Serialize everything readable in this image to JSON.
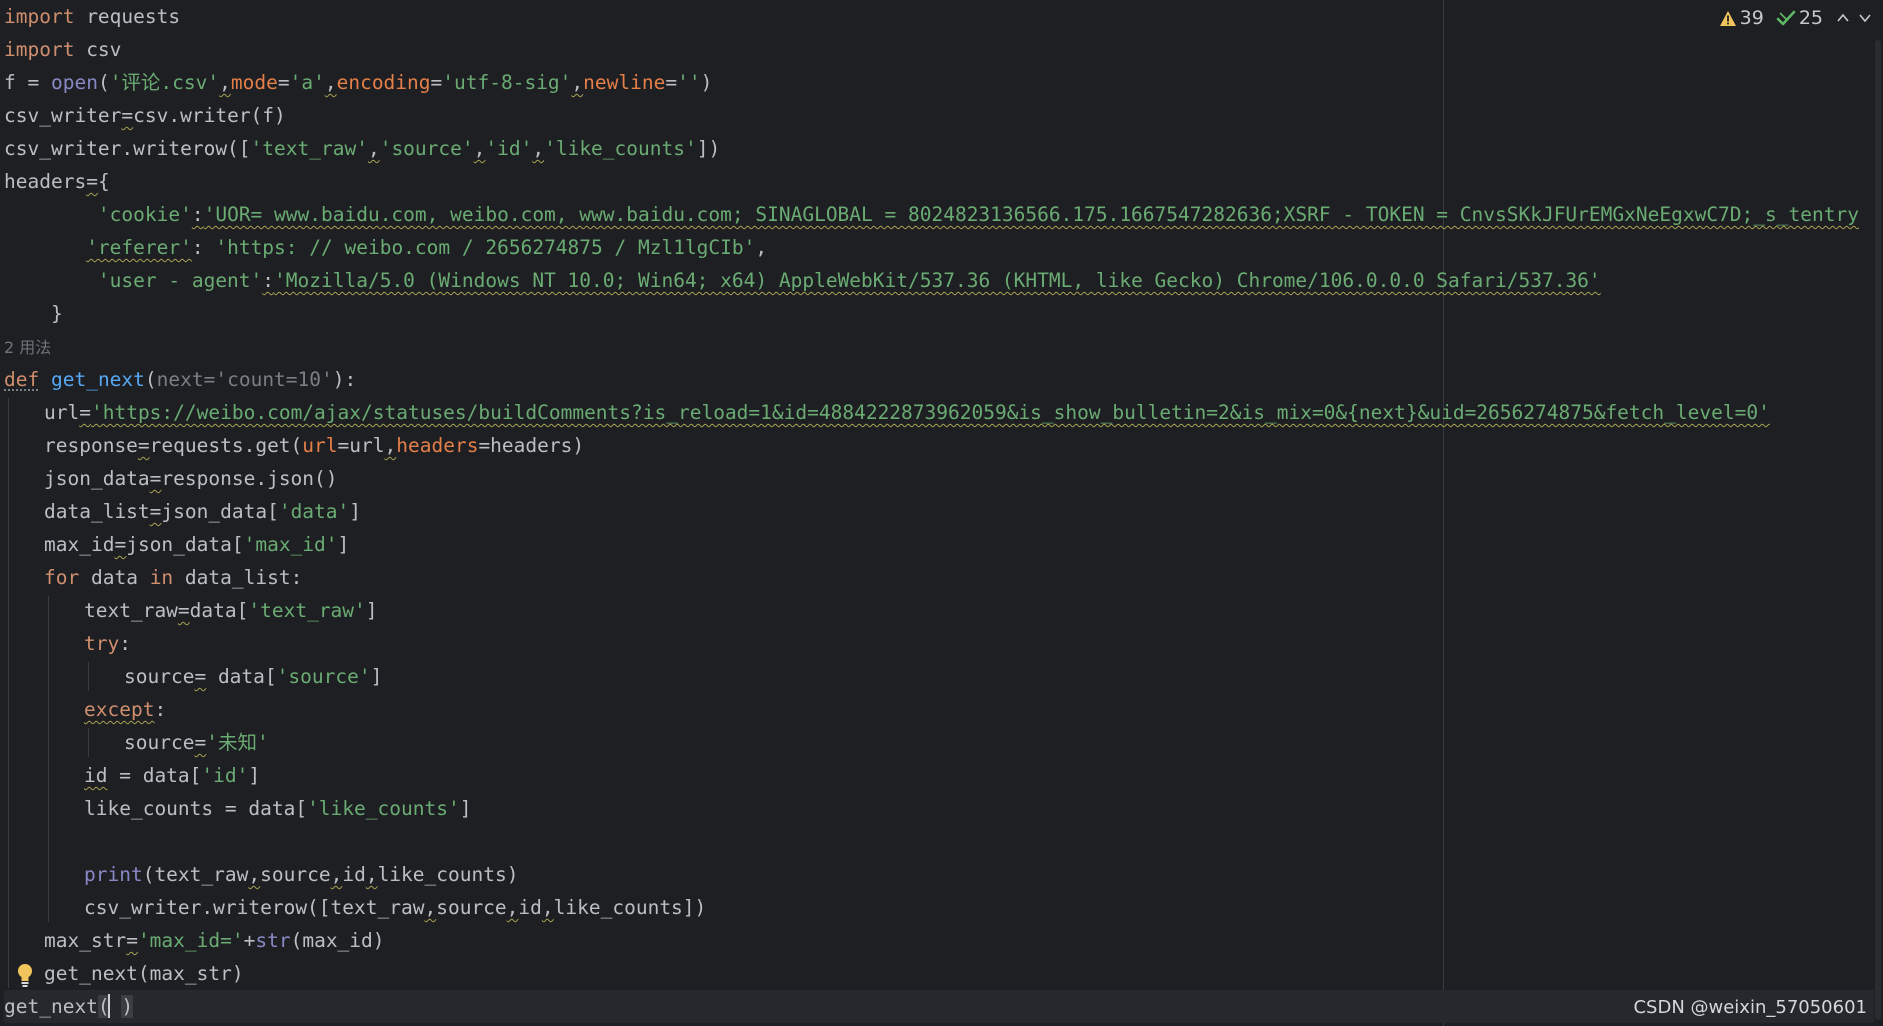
{
  "inspection_widget": {
    "warning_count": "39",
    "weak_warning_count": "25"
  },
  "usage_hint": "2 用法",
  "watermark": "CSDN @weixin_57050601",
  "colors": {
    "background": "#1e1f22",
    "keyword": "#cf8e6d",
    "string": "#6aab73",
    "function": "#56a8f5",
    "builtin": "#8888c6",
    "parameter": "#e57f4a",
    "default_text": "#bcbec4"
  },
  "code_lines": [
    {
      "indent": 0,
      "tokens": [
        {
          "t": "import",
          "c": "kw"
        },
        {
          "t": " requests"
        }
      ]
    },
    {
      "indent": 0,
      "tokens": [
        {
          "t": "import",
          "c": "kw"
        },
        {
          "t": " csv"
        }
      ]
    },
    {
      "indent": 0,
      "tokens": [
        {
          "t": "f = "
        },
        {
          "t": "open",
          "c": "bi"
        },
        {
          "t": "("
        },
        {
          "t": "'评论.csv'",
          "c": "str"
        },
        {
          "t": ",",
          "w": 1
        },
        {
          "t": "mode",
          "c": "param"
        },
        {
          "t": "="
        },
        {
          "t": "'a'",
          "c": "str"
        },
        {
          "t": ",",
          "w": 1
        },
        {
          "t": "encoding",
          "c": "param"
        },
        {
          "t": "="
        },
        {
          "t": "'utf-8-sig'",
          "c": "str"
        },
        {
          "t": ",",
          "w": 1
        },
        {
          "t": "newline",
          "c": "param"
        },
        {
          "t": "="
        },
        {
          "t": "''",
          "c": "str"
        },
        {
          "t": ")"
        }
      ]
    },
    {
      "indent": 0,
      "tokens": [
        {
          "t": "csv_writer"
        },
        {
          "t": "=",
          "w": 1
        },
        {
          "t": "csv.writer(f)"
        }
      ]
    },
    {
      "indent": 0,
      "tokens": [
        {
          "t": "csv_writer.writerow(["
        },
        {
          "t": "'text_raw'",
          "c": "str"
        },
        {
          "t": ",",
          "w": 1
        },
        {
          "t": "'source'",
          "c": "str"
        },
        {
          "t": ",",
          "w": 1
        },
        {
          "t": "'id'",
          "c": "str"
        },
        {
          "t": ",",
          "w": 1
        },
        {
          "t": "'like_counts'",
          "c": "str"
        },
        {
          "t": "])"
        }
      ]
    },
    {
      "indent": 0,
      "tokens": [
        {
          "t": "headers"
        },
        {
          "t": "=",
          "w": 1
        },
        {
          "t": "{"
        }
      ]
    },
    {
      "indent": 0,
      "tokens": [
        {
          "t": "        "
        },
        {
          "t": "'cookie'",
          "c": "str"
        },
        {
          "t": ":",
          "w": 1
        },
        {
          "t": "'UOR= www.baidu.com, weibo.com, www.baidu.com; SINAGLOBAL = 8024823136566.175.1667547282636;XSRF - TOKEN = CnvsSKkJFUrEMGxNeEgxwC7D;_s_tentry",
          "c": "str",
          "w": 1
        }
      ]
    },
    {
      "indent": 0,
      "tokens": [
        {
          "t": "       "
        },
        {
          "t": "'referer'",
          "c": "str",
          "w": 1
        },
        {
          "t": ": "
        },
        {
          "t": "'https: // weibo.com / 2656274875 / Mzl1lgCIb'",
          "c": "str"
        },
        {
          "t": ","
        }
      ]
    },
    {
      "indent": 0,
      "tokens": [
        {
          "t": "        "
        },
        {
          "t": "'user - agent'",
          "c": "str"
        },
        {
          "t": ":",
          "w": 1
        },
        {
          "t": "'Mozilla/5.0 (Windows NT 10.0; Win64; x64) AppleWebKit/537.36 (KHTML, like Gecko) Chrome/106.0.0.0 Safari/537.36'",
          "c": "str",
          "w": 1
        }
      ]
    },
    {
      "indent": 0,
      "tokens": [
        {
          "t": "    }"
        }
      ]
    },
    {
      "indent": 0,
      "kind": "usage",
      "tokens": [
        {
          "t": "2 用法",
          "c": "usage"
        }
      ]
    },
    {
      "indent": 0,
      "tokens": [
        {
          "t": "def",
          "c": "kw",
          "d": 1
        },
        {
          "t": " "
        },
        {
          "t": "get_next",
          "c": "fn"
        },
        {
          "t": "("
        },
        {
          "t": "next=",
          "c": "hint"
        },
        {
          "t": "'count=10'",
          "c": "hint"
        },
        {
          "t": "):"
        }
      ]
    },
    {
      "indent": 1,
      "tokens": [
        {
          "t": "url"
        },
        {
          "t": "=",
          "w": 1
        },
        {
          "t": "'https://weibo.com/ajax/statuses/buildComments?is_reload=1&id=4884222873962059&is_show_bulletin=2&is_mix=0&{next}&uid=2656274875&fetch_level=0'",
          "c": "str",
          "w": 1
        }
      ]
    },
    {
      "indent": 1,
      "tokens": [
        {
          "t": "response"
        },
        {
          "t": "=",
          "w": 1
        },
        {
          "t": "requests.get("
        },
        {
          "t": "url",
          "c": "param"
        },
        {
          "t": "=url"
        },
        {
          "t": ",",
          "w": 1
        },
        {
          "t": "headers",
          "c": "param"
        },
        {
          "t": "=headers)"
        }
      ]
    },
    {
      "indent": 1,
      "tokens": [
        {
          "t": "json_data"
        },
        {
          "t": "=",
          "w": 1
        },
        {
          "t": "response.json()"
        }
      ]
    },
    {
      "indent": 1,
      "tokens": [
        {
          "t": "data_list"
        },
        {
          "t": "=",
          "w": 1
        },
        {
          "t": "json_data["
        },
        {
          "t": "'data'",
          "c": "str"
        },
        {
          "t": "]"
        }
      ]
    },
    {
      "indent": 1,
      "tokens": [
        {
          "t": "max_id"
        },
        {
          "t": "=",
          "w": 1
        },
        {
          "t": "json_data["
        },
        {
          "t": "'max_id'",
          "c": "str"
        },
        {
          "t": "]"
        }
      ]
    },
    {
      "indent": 1,
      "tokens": [
        {
          "t": "for",
          "c": "kw"
        },
        {
          "t": " data "
        },
        {
          "t": "in",
          "c": "kw"
        },
        {
          "t": " data_list:"
        }
      ]
    },
    {
      "indent": 2,
      "tokens": [
        {
          "t": "text_raw"
        },
        {
          "t": "=",
          "w": 1
        },
        {
          "t": "data["
        },
        {
          "t": "'text_raw'",
          "c": "str"
        },
        {
          "t": "]"
        }
      ]
    },
    {
      "indent": 2,
      "tokens": [
        {
          "t": "try",
          "c": "kw"
        },
        {
          "t": ":"
        }
      ]
    },
    {
      "indent": 3,
      "tokens": [
        {
          "t": "source"
        },
        {
          "t": "=",
          "w": 1
        },
        {
          "t": " data["
        },
        {
          "t": "'source'",
          "c": "str"
        },
        {
          "t": "]"
        }
      ]
    },
    {
      "indent": 2,
      "tokens": [
        {
          "t": "except",
          "c": "kw",
          "w": 1
        },
        {
          "t": ":"
        }
      ]
    },
    {
      "indent": 3,
      "tokens": [
        {
          "t": "source"
        },
        {
          "t": "=",
          "w": 1
        },
        {
          "t": "'未知'",
          "c": "str"
        }
      ]
    },
    {
      "indent": 2,
      "tokens": [
        {
          "t": "id",
          "w": 1
        },
        {
          "t": " = data["
        },
        {
          "t": "'id'",
          "c": "str"
        },
        {
          "t": "]"
        }
      ]
    },
    {
      "indent": 2,
      "tokens": [
        {
          "t": "like_counts = data["
        },
        {
          "t": "'like_counts'",
          "c": "str"
        },
        {
          "t": "]"
        }
      ]
    },
    {
      "indent": 2,
      "tokens": []
    },
    {
      "indent": 2,
      "tokens": [
        {
          "t": "print",
          "c": "bi"
        },
        {
          "t": "(text_raw"
        },
        {
          "t": ",",
          "w": 1
        },
        {
          "t": "source"
        },
        {
          "t": ",",
          "w": 1
        },
        {
          "t": "id"
        },
        {
          "t": ",",
          "w": 1
        },
        {
          "t": "like_counts)"
        }
      ]
    },
    {
      "indent": 2,
      "tokens": [
        {
          "t": "csv_writer.writerow([text_raw"
        },
        {
          "t": ",",
          "w": 1
        },
        {
          "t": "source"
        },
        {
          "t": ",",
          "w": 1
        },
        {
          "t": "id"
        },
        {
          "t": ",",
          "w": 1
        },
        {
          "t": "like_counts])"
        }
      ]
    },
    {
      "indent": 1,
      "tokens": [
        {
          "t": "max_str"
        },
        {
          "t": "=",
          "w": 1
        },
        {
          "t": "'max_id='",
          "c": "str"
        },
        {
          "t": "+"
        },
        {
          "t": "str",
          "c": "bi"
        },
        {
          "t": "(max_id)"
        }
      ]
    },
    {
      "indent": 1,
      "tokens": [
        {
          "t": "get_next(max_str)"
        }
      ]
    },
    {
      "indent": 0,
      "kind": "current",
      "tokens": [
        {
          "t": "get_next"
        },
        {
          "t": "(",
          "c": "cursor"
        },
        {
          "t": " "
        },
        {
          "t": ")",
          "c": "cursor"
        }
      ]
    }
  ]
}
